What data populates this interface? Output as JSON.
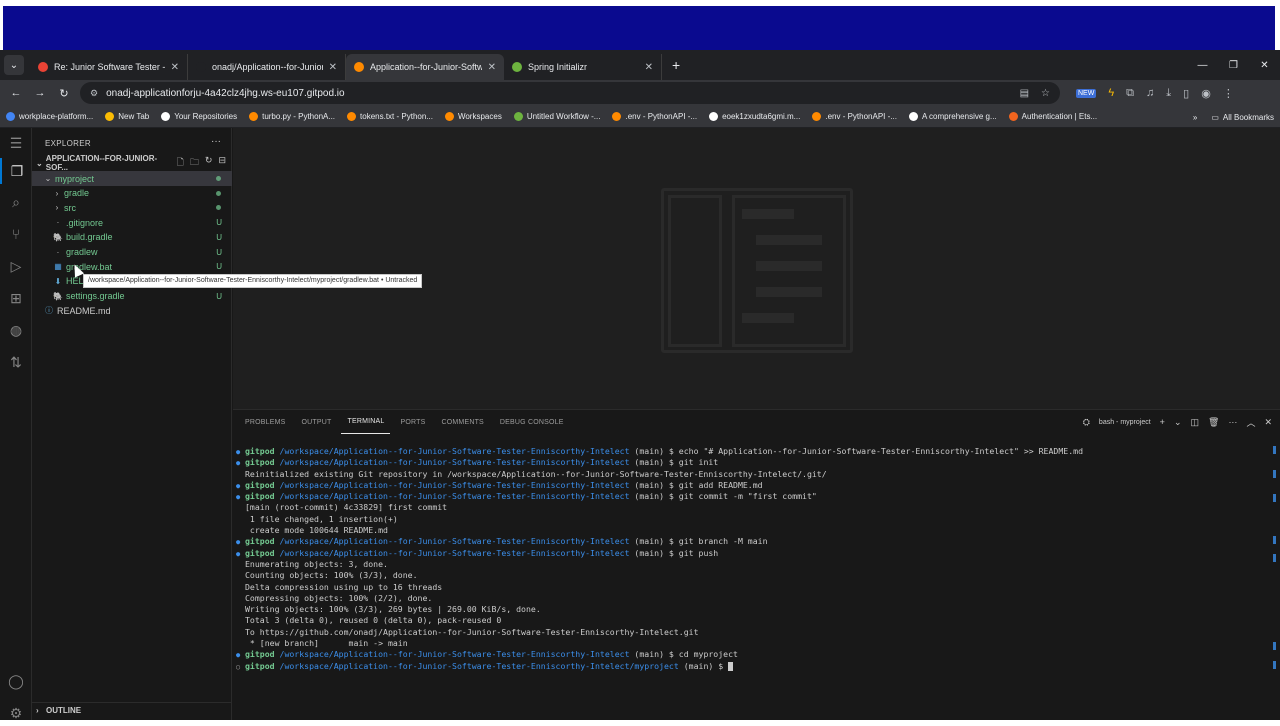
{
  "browser": {
    "tabs": [
      {
        "title": "Re: Junior Software Tester - OLIO",
        "favicon": "gmail-icon",
        "color": "#ea4335",
        "active": false
      },
      {
        "title": "onadj/Application--for-Junior-S",
        "favicon": "github-icon",
        "color": "#202124",
        "active": false
      },
      {
        "title": "Application--for-Junior-Softwar",
        "favicon": "gitpod-icon",
        "color": "#ff8a00",
        "active": true
      },
      {
        "title": "Spring Initializr",
        "favicon": "spring-icon",
        "color": "#6db33f",
        "active": false
      }
    ],
    "new_tab": "+",
    "url": "onadj-applicationforju-4a42clz4jhg.ws-eu107.gitpod.io",
    "bookmarks": [
      {
        "label": "workplace-platform...",
        "color": "#4285f4"
      },
      {
        "label": "New Tab",
        "color": "#fbbc04"
      },
      {
        "label": "Your Repositories",
        "color": "#ffffff"
      },
      {
        "label": "turbo.py - PythonA...",
        "color": "#ff8a00"
      },
      {
        "label": "tokens.txt - Python...",
        "color": "#ff8a00"
      },
      {
        "label": "Workspaces",
        "color": "#ff8a00"
      },
      {
        "label": "Untitled Workflow -...",
        "color": "#6db33f"
      },
      {
        "label": ".env - PythonAPI -...",
        "color": "#ff8a00"
      },
      {
        "label": "eoek1zxudta6gmi.m...",
        "color": "#ffffff"
      },
      {
        "label": ".env - PythonAPI -...",
        "color": "#ff8a00"
      },
      {
        "label": "A comprehensive g...",
        "color": "#ffffff"
      },
      {
        "label": "Authentication | Ets...",
        "color": "#f1641e"
      }
    ],
    "all_bookmarks": "All Bookmarks"
  },
  "vscode": {
    "explorer_title": "EXPLORER",
    "root_folder": "APPLICATION--FOR-JUNIOR-SOF...",
    "tree": [
      {
        "name": "myproject",
        "indent": 1,
        "kind": "folder-open",
        "status": "dot",
        "selected": true
      },
      {
        "name": "gradle",
        "indent": 2,
        "kind": "folder",
        "status": "dot"
      },
      {
        "name": "src",
        "indent": 2,
        "kind": "folder",
        "status": "dot"
      },
      {
        "name": ".gitignore",
        "indent": 2,
        "kind": "file",
        "status": "U"
      },
      {
        "name": "build.gradle",
        "indent": 2,
        "kind": "gradle",
        "status": "U"
      },
      {
        "name": "gradlew",
        "indent": 2,
        "kind": "file",
        "status": "U"
      },
      {
        "name": "gradlew.bat",
        "indent": 2,
        "kind": "bat",
        "status": "U"
      },
      {
        "name": "HELP.md",
        "indent": 2,
        "kind": "md",
        "status": "U"
      },
      {
        "name": "settings.gradle",
        "indent": 2,
        "kind": "gradle",
        "status": "U"
      },
      {
        "name": "README.md",
        "indent": 1,
        "kind": "info",
        "status": ""
      }
    ],
    "tooltip": "/workspace/Application--for-Junior-Software-Tester-Enniscorthy-Intelect/myproject/gradlew.bat • Untracked",
    "outline_label": "OUTLINE",
    "panel_tabs": [
      "PROBLEMS",
      "OUTPUT",
      "TERMINAL",
      "PORTS",
      "COMMENTS",
      "DEBUG CONSOLE"
    ],
    "active_panel_tab": "TERMINAL",
    "terminal_name": "bash - myproject",
    "terminal_lines": [
      {
        "type": "prompt",
        "path": "/workspace/Application--for-Junior-Software-Tester-Enniscorthy-Intelect",
        "cmd": " (main) $ echo \"# Application--for-Junior-Software-Tester-Enniscorthy-Intelect\" >> README.md"
      },
      {
        "type": "prompt",
        "path": "/workspace/Application--for-Junior-Software-Tester-Enniscorthy-Intelect",
        "cmd": " (main) $ git init"
      },
      {
        "type": "out",
        "text": "Reinitialized existing Git repository in /workspace/Application--for-Junior-Software-Tester-Enniscorthy-Intelect/.git/"
      },
      {
        "type": "prompt",
        "path": "/workspace/Application--for-Junior-Software-Tester-Enniscorthy-Intelect",
        "cmd": " (main) $ git add README.md"
      },
      {
        "type": "prompt",
        "path": "/workspace/Application--for-Junior-Software-Tester-Enniscorthy-Intelect",
        "cmd": " (main) $ git commit -m \"first commit\""
      },
      {
        "type": "out",
        "text": "[main (root-commit) 4c33829] first commit"
      },
      {
        "type": "out",
        "text": " 1 file changed, 1 insertion(+)"
      },
      {
        "type": "out",
        "text": " create mode 100644 README.md"
      },
      {
        "type": "prompt",
        "path": "/workspace/Application--for-Junior-Software-Tester-Enniscorthy-Intelect",
        "cmd": " (main) $ git branch -M main"
      },
      {
        "type": "prompt",
        "path": "/workspace/Application--for-Junior-Software-Tester-Enniscorthy-Intelect",
        "cmd": " (main) $ git push"
      },
      {
        "type": "out",
        "text": "Enumerating objects: 3, done."
      },
      {
        "type": "out",
        "text": "Counting objects: 100% (3/3), done."
      },
      {
        "type": "out",
        "text": "Delta compression using up to 16 threads"
      },
      {
        "type": "out",
        "text": "Compressing objects: 100% (2/2), done."
      },
      {
        "type": "out",
        "text": "Writing objects: 100% (3/3), 269 bytes | 269.00 KiB/s, done."
      },
      {
        "type": "out",
        "text": "Total 3 (delta 0), reused 0 (delta 0), pack-reused 0"
      },
      {
        "type": "out",
        "text": "To https://github.com/onadj/Application--for-Junior-Software-Tester-Enniscorthy-Intelect.git"
      },
      {
        "type": "out",
        "text": " * [new branch]      main -> main"
      },
      {
        "type": "prompt",
        "path": "/workspace/Application--for-Junior-Software-Tester-Enniscorthy-Intelect",
        "cmd": " (main) $ cd myproject"
      },
      {
        "type": "current",
        "path": "/workspace/Application--for-Junior-Software-Tester-Enniscorthy-Intelect/myproject",
        "cmd": " (main) $ "
      }
    ],
    "prompt_user": "gitpod",
    "colors": {
      "untracked": "#73c991",
      "path": "#3b8eea",
      "accent": "#0078d4"
    }
  }
}
